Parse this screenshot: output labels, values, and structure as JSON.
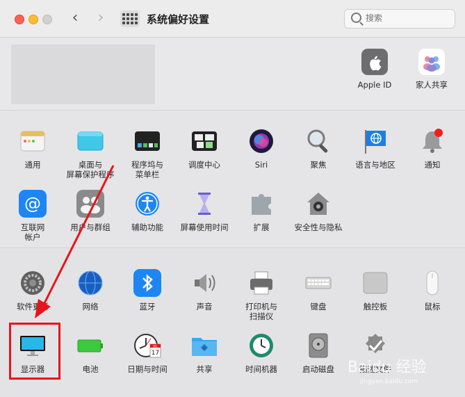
{
  "window": {
    "title": "系统偏好设置"
  },
  "search": {
    "placeholder": "搜索"
  },
  "account": {
    "items": [
      {
        "label": "Apple ID"
      },
      {
        "label": "家人共享"
      }
    ]
  },
  "row1": [
    {
      "label": "通用"
    },
    {
      "label": "桌面与\n屏幕保护程序"
    },
    {
      "label": "程序坞与\n菜单栏"
    },
    {
      "label": "调度中心"
    },
    {
      "label": "Siri"
    },
    {
      "label": "聚焦"
    },
    {
      "label": "语言与地区"
    },
    {
      "label": "通知"
    }
  ],
  "row2": [
    {
      "label": "互联网\n帐户"
    },
    {
      "label": "用户与群组"
    },
    {
      "label": "辅助功能"
    },
    {
      "label": "屏幕使用时间"
    },
    {
      "label": "扩展"
    },
    {
      "label": "安全性与隐私"
    }
  ],
  "row3": [
    {
      "label": "软件更新"
    },
    {
      "label": "网络"
    },
    {
      "label": "蓝牙"
    },
    {
      "label": "声音"
    },
    {
      "label": "打印机与\n扫描仪"
    },
    {
      "label": "键盘"
    },
    {
      "label": "触控板"
    },
    {
      "label": "鼠标"
    }
  ],
  "row4": [
    {
      "label": "显示器"
    },
    {
      "label": "电池"
    },
    {
      "label": "日期与时间"
    },
    {
      "label": "共享"
    },
    {
      "label": "时间机器"
    },
    {
      "label": "启动磁盘"
    },
    {
      "label": "描述文件"
    }
  ],
  "calendar": {
    "month": "JUL",
    "day": "17"
  },
  "colors": {
    "accent": "#e8141b",
    "highlight_box": "#e8141b"
  },
  "watermark": {
    "text": "Baidu 经验",
    "sub": "jingyan.baidu.com"
  }
}
